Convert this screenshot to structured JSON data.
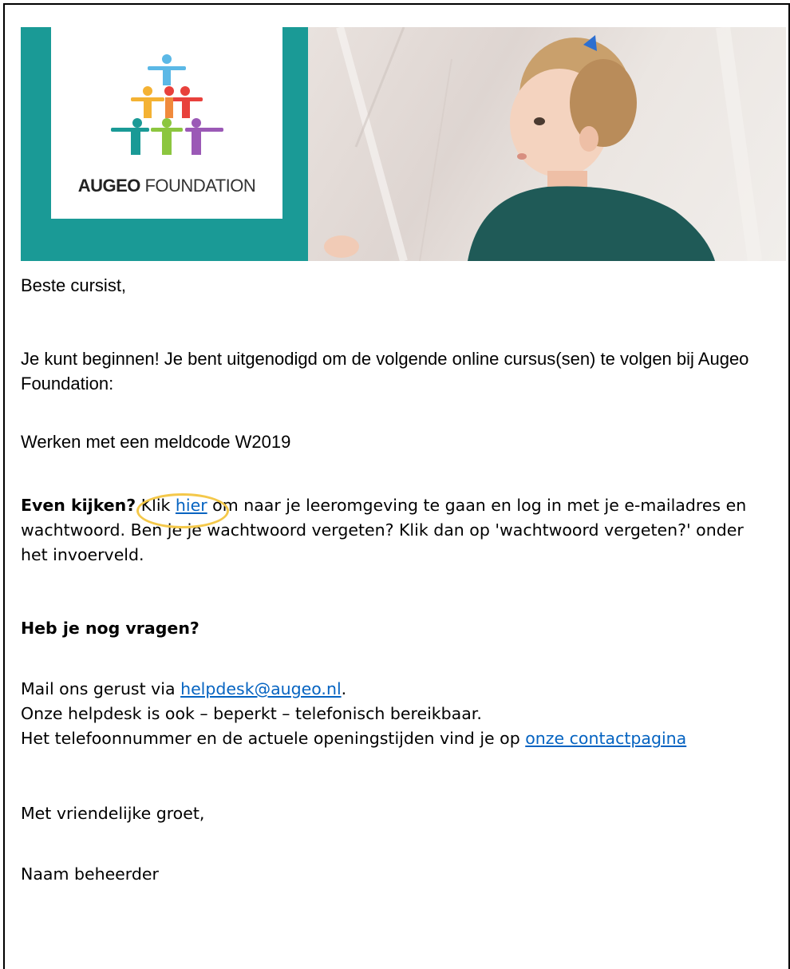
{
  "banner": {
    "logo_bold": "AUGEO",
    "logo_rest": " FOUNDATION",
    "colors": {
      "teal": "#1a9a96",
      "logo_text": "#333333"
    }
  },
  "email": {
    "greeting": "Beste cursist,",
    "intro": "Je kunt beginnen! Je bent uitgenodigd om de volgende online cursus(sen) te volgen bij Augeo Foundation:",
    "course": "Werken met een meldcode W2019",
    "cta_bold": "Even kijken?",
    "cta_pre": " Klik ",
    "cta_link": "hier",
    "cta_post": " om naar je leeromgeving te gaan en log in met je e-mailadres en wachtwoord. Ben je je wachtwoord vergeten? Klik dan op 'wachtwoord vergeten?' onder het invoerveld.",
    "questions_heading": "Heb je nog vragen?",
    "mail_pre": "Mail ons gerust via ",
    "mail_link": "helpdesk@augeo.nl",
    "mail_post": ".",
    "phone_line": "Onze helpdesk is ook – beperkt – telefonisch bereikbaar.",
    "hours_pre": "Het telefoonnummer en de actuele openingstijden vind je op ",
    "hours_link": "onze contactpagina",
    "closing": "Met vriendelijke groet,",
    "signature": "Naam beheerder"
  },
  "colors": {
    "link": "#0563c1",
    "highlight_circle": "#f4c84a"
  }
}
